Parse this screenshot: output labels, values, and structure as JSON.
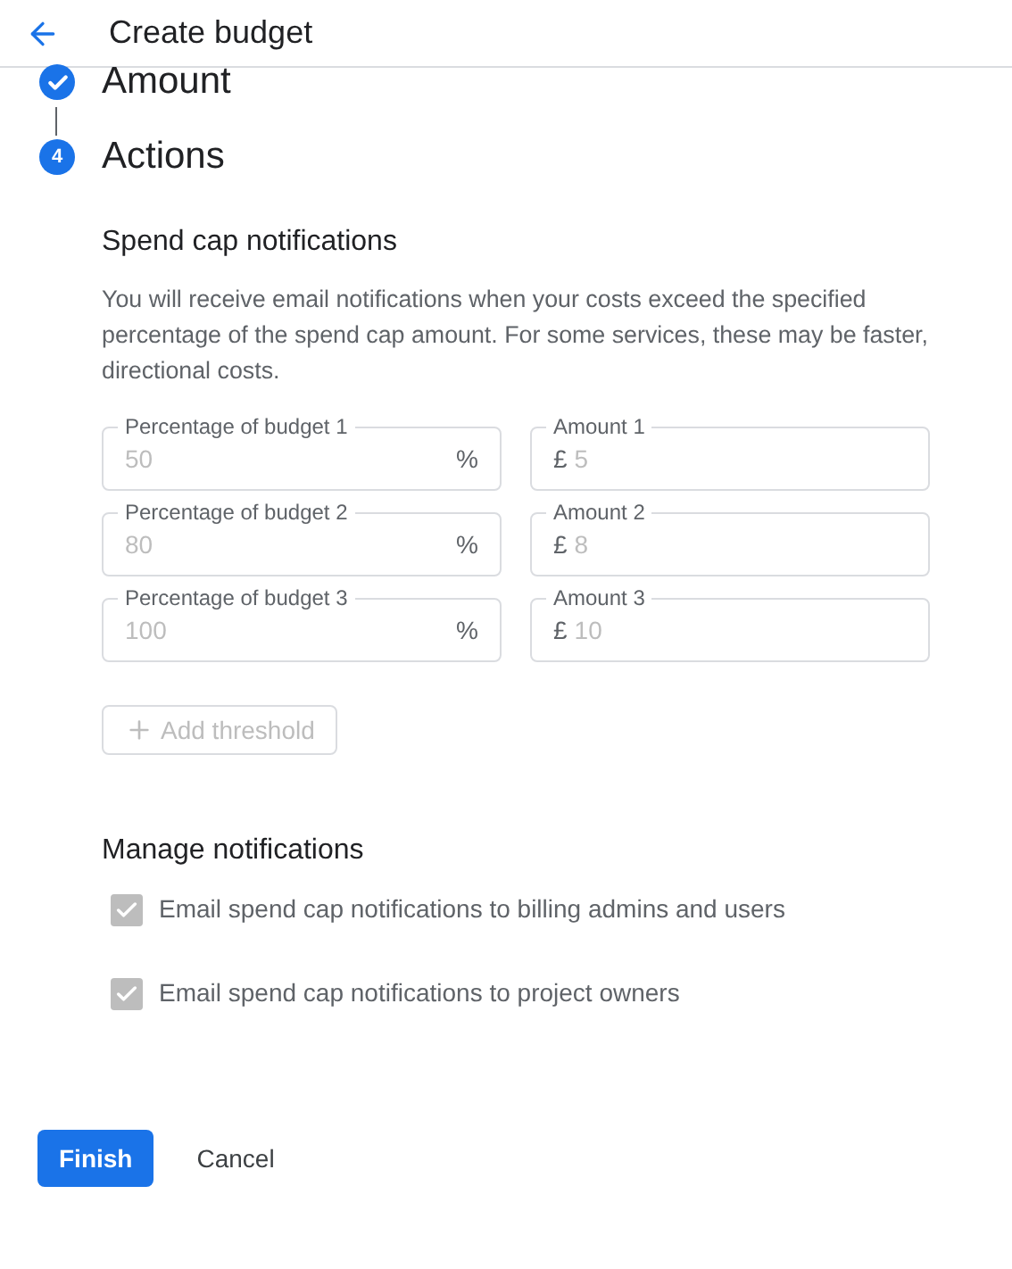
{
  "header": {
    "title": "Create budget"
  },
  "steps": [
    {
      "kind": "done",
      "title": "Amount"
    },
    {
      "kind": "current",
      "number": "4",
      "title": "Actions"
    }
  ],
  "spend_cap": {
    "title": "Spend cap notifications",
    "description": "You will receive email notifications when your costs exceed the specified percentage of the spend cap amount. For some services, these may be faster, directional costs.",
    "thresholds": [
      {
        "percent_label": "Percentage of budget 1",
        "percent_value": "50",
        "percent_suffix": "%",
        "amount_label": "Amount 1",
        "currency": "£",
        "amount_value": "5",
        "disabled": true
      },
      {
        "percent_label": "Percentage of budget 2",
        "percent_value": "80",
        "percent_suffix": "%",
        "amount_label": "Amount 2",
        "currency": "£",
        "amount_value": "8",
        "disabled": true
      },
      {
        "percent_label": "Percentage of budget 3",
        "percent_value": "100",
        "percent_suffix": "%",
        "amount_label": "Amount 3",
        "currency": "£",
        "amount_value": "10",
        "disabled": true
      }
    ],
    "add_button": {
      "label": "Add threshold",
      "disabled": true
    }
  },
  "manage": {
    "title": "Manage notifications",
    "options": [
      {
        "label": "Email spend cap notifications to billing admins and users",
        "checked": true,
        "disabled": true
      },
      {
        "label": "Email spend cap notifications to project owners",
        "checked": true,
        "disabled": true
      }
    ]
  },
  "buttons": {
    "primary": "Finish",
    "secondary": "Cancel"
  }
}
